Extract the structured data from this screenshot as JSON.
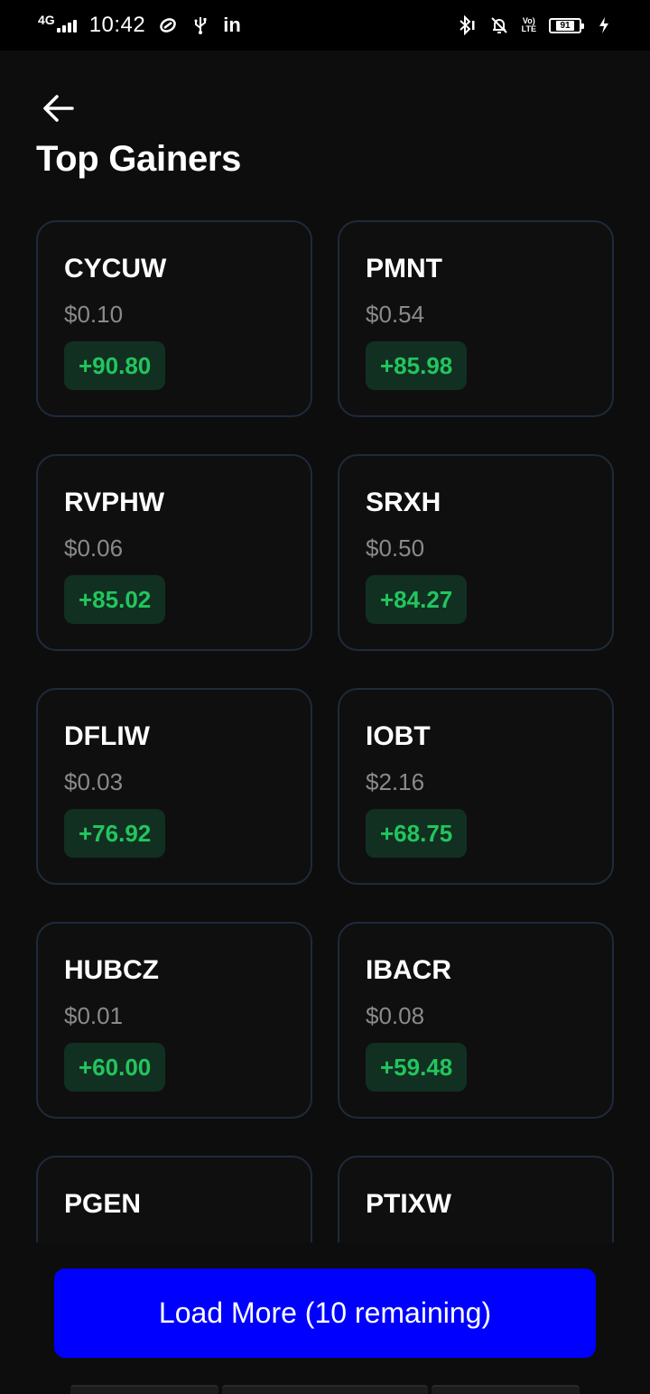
{
  "status_bar": {
    "network": "4G",
    "time": "10:42",
    "linkedin": "in",
    "volte": "Vo LTE",
    "battery": "91"
  },
  "header": {
    "title": "Top Gainers"
  },
  "gainers": [
    {
      "symbol": "CYCUW",
      "price": "$0.10",
      "change": "+90.80"
    },
    {
      "symbol": "PMNT",
      "price": "$0.54",
      "change": "+85.98"
    },
    {
      "symbol": "RVPHW",
      "price": "$0.06",
      "change": "+85.02"
    },
    {
      "symbol": "SRXH",
      "price": "$0.50",
      "change": "+84.27"
    },
    {
      "symbol": "DFLIW",
      "price": "$0.03",
      "change": "+76.92"
    },
    {
      "symbol": "IOBT",
      "price": "$2.16",
      "change": "+68.75"
    },
    {
      "symbol": "HUBCZ",
      "price": "$0.01",
      "change": "+60.00"
    },
    {
      "symbol": "IBACR",
      "price": "$0.08",
      "change": "+59.48"
    },
    {
      "symbol": "PGEN",
      "price": "",
      "change": ""
    },
    {
      "symbol": "PTIXW",
      "price": "",
      "change": ""
    }
  ],
  "load_more": {
    "label": "Load More (10 remaining)"
  },
  "colors": {
    "background": "#0d0d0d",
    "card_border": "#1f2a3a",
    "gain_text": "#22c55e",
    "gain_bg": "#123021",
    "button": "#0000ff"
  }
}
